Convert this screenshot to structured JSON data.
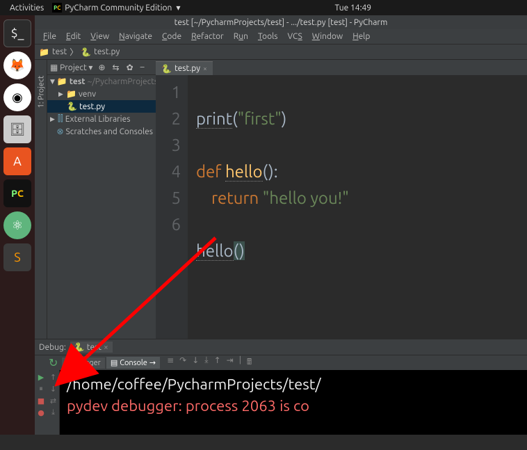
{
  "gnome": {
    "activities": "Activities",
    "app": "PyCharm Community Edition",
    "clock": "Tue 14:49"
  },
  "title": "test [~/PycharmProjects/test] - .../test.py [test] - PyCharm",
  "menu": [
    "File",
    "Edit",
    "View",
    "Navigate",
    "Code",
    "Refactor",
    "Run",
    "Tools",
    "VCS",
    "Window",
    "Help"
  ],
  "crumb": {
    "folder": "test",
    "file": "test.py"
  },
  "project": {
    "label": "Project",
    "root": "test",
    "rootPath": "~/PycharmProjects",
    "venv": "venv",
    "file": "test.py",
    "ext": "External Libraries",
    "scratch": "Scratches and Consoles"
  },
  "editorTab": "test.py",
  "code": {
    "lines": [
      "1",
      "2",
      "3",
      "4",
      "5",
      "6"
    ],
    "l1a": "print",
    "l1b": "(",
    "l1c": "\"first\"",
    "l1d": ")",
    "l3a": "def ",
    "l3b": "hello",
    "l3c": "():",
    "l4a": "    ",
    "l4b": "return ",
    "l4c": "\"hello you!\"",
    "l6a": "hello",
    "l6b": "(",
    "l6c": ")"
  },
  "debug": {
    "title": "Debug:",
    "config": "test",
    "tabDebugger": "Debugger",
    "tabConsole": "Console",
    "out1": "/home/coffee/PycharmProjects/test/",
    "out2": "pydev debugger: process 2063 is co"
  }
}
